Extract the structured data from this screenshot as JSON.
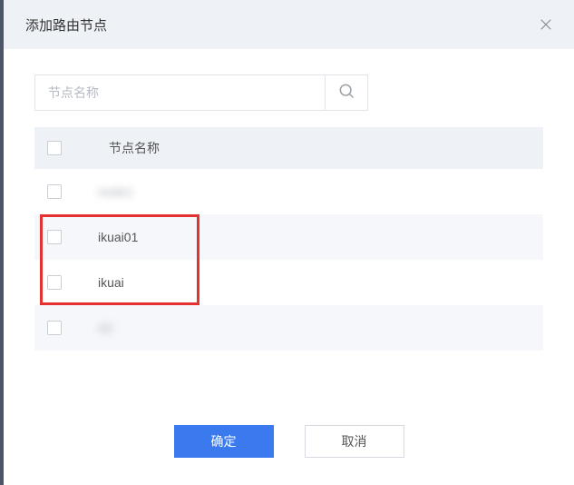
{
  "header": {
    "title": "添加路由节点"
  },
  "search": {
    "placeholder": "节点名称"
  },
  "table": {
    "header_label": "节点名称",
    "rows": [
      {
        "name": "node1",
        "blurred": true
      },
      {
        "name": "ikuai01",
        "blurred": false
      },
      {
        "name": "ikuai",
        "blurred": false
      },
      {
        "name": "rt2",
        "blurred": true
      }
    ]
  },
  "footer": {
    "confirm": "确定",
    "cancel": "取消"
  }
}
